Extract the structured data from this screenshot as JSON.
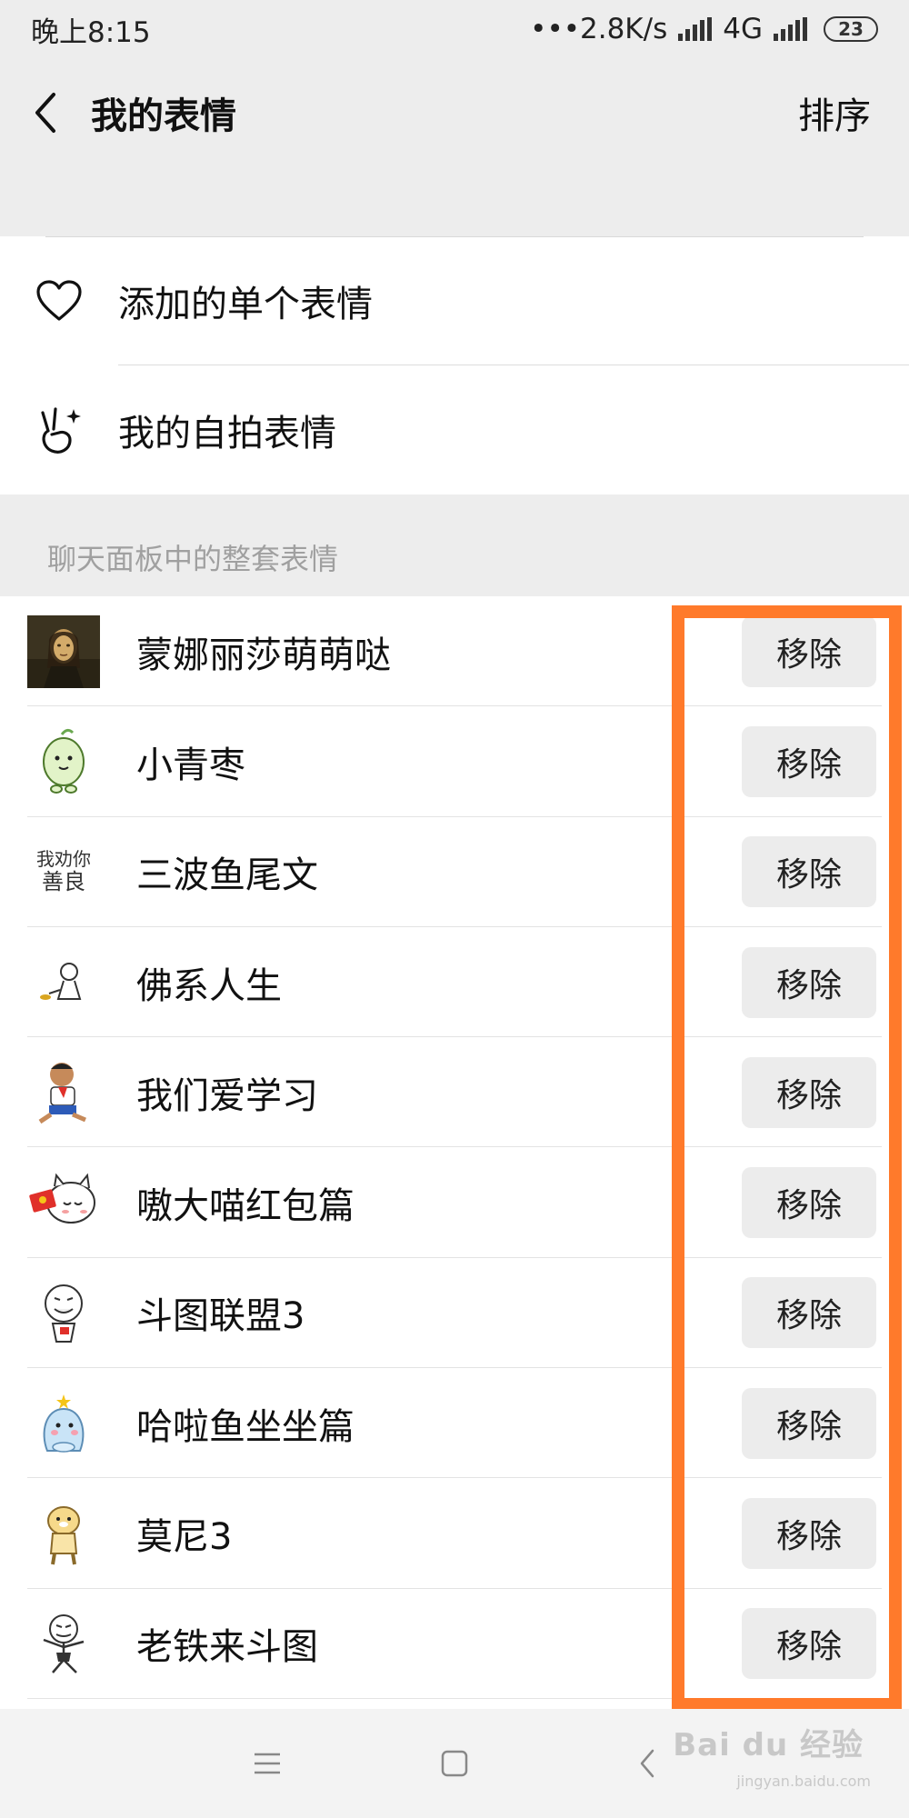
{
  "status_bar": {
    "time": "晚上8:15",
    "network_speed": "•••2.8K/s",
    "network_type": "4G",
    "battery": "23"
  },
  "nav": {
    "title": "我的表情",
    "sort_label": "排序"
  },
  "top_items": [
    {
      "label": "添加的单个表情",
      "icon": "heart-icon"
    },
    {
      "label": "我的自拍表情",
      "icon": "selfie-hand-icon"
    }
  ],
  "section_header": "聊天面板中的整套表情",
  "sticker_packs": [
    {
      "name": "蒙娜丽莎萌萌哒",
      "remove_label": "移除",
      "thumb": "mona-lisa"
    },
    {
      "name": "小青枣",
      "remove_label": "移除",
      "thumb": "green-date"
    },
    {
      "name": "三波鱼尾文",
      "remove_label": "移除",
      "thumb": "handwriting",
      "thumb_text_1": "我劝你",
      "thumb_text_2": "善良"
    },
    {
      "name": "佛系人生",
      "remove_label": "移除",
      "thumb": "buddha-stickman"
    },
    {
      "name": "我们爱学习",
      "remove_label": "移除",
      "thumb": "student-boy"
    },
    {
      "name": "嗷大喵红包篇",
      "remove_label": "移除",
      "thumb": "cat-red-envelope"
    },
    {
      "name": "斗图联盟3",
      "remove_label": "移除",
      "thumb": "meme-face"
    },
    {
      "name": "哈啦鱼坐坐篇",
      "remove_label": "移除",
      "thumb": "blue-fish"
    },
    {
      "name": "莫尼3",
      "remove_label": "移除",
      "thumb": "yellow-otter"
    },
    {
      "name": "老铁来斗图",
      "remove_label": "移除",
      "thumb": "meme-stickman"
    }
  ],
  "watermark": {
    "text": "Bai du 经验",
    "sub": "jingyan.baidu.com"
  },
  "colors": {
    "highlight": "#ff7a2b",
    "background": "#ededed"
  }
}
